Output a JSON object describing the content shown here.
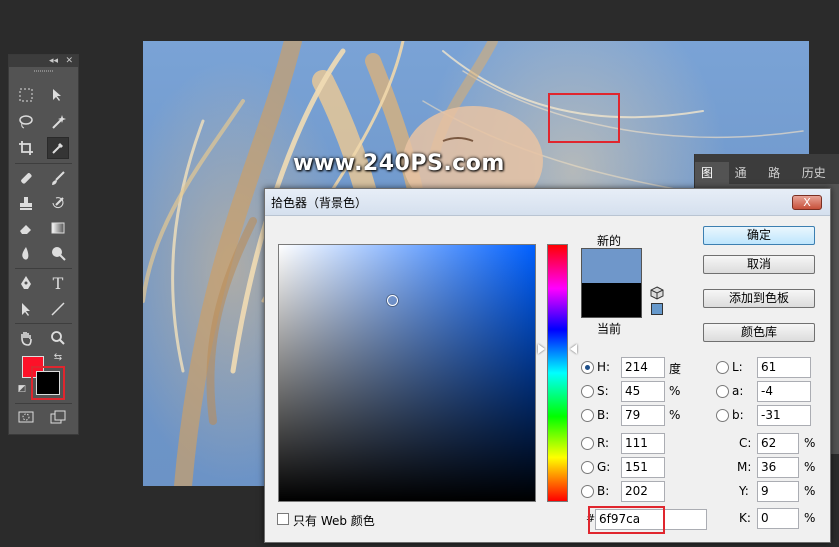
{
  "canvas": {
    "watermark": "www.240PS.com"
  },
  "toolbox": {
    "collapse_glyph": "◂◂",
    "close_glyph": "✕",
    "foreground_color": "#fd1128",
    "background_color": "#000000"
  },
  "layers_panel": {
    "tabs": [
      "图层",
      "通道",
      "路径",
      "历史记"
    ]
  },
  "dialog": {
    "title": "拾色器（背景色）",
    "close_label": "X",
    "new_label": "新的",
    "current_label": "当前",
    "new_color": "#6f97ca",
    "current_color": "#000000",
    "buttons": {
      "ok": "确定",
      "cancel": "取消",
      "add_to_swatches": "添加到色板",
      "color_libraries": "颜色库"
    },
    "hsb": {
      "h_label": "H:",
      "h_value": "214",
      "h_unit": "度",
      "s_label": "S:",
      "s_value": "45",
      "s_unit": "%",
      "b_label": "B:",
      "b_value": "79",
      "b_unit": "%"
    },
    "rgb": {
      "r_label": "R:",
      "r_value": "111",
      "g_label": "G:",
      "g_value": "151",
      "b_label": "B:",
      "b_value": "202"
    },
    "lab": {
      "l_label": "L:",
      "l_value": "61",
      "a_label": "a:",
      "a_value": "-4",
      "b_label": "b:",
      "b_value": "-31"
    },
    "cmyk": {
      "c_label": "C:",
      "c_value": "62",
      "m_label": "M:",
      "m_value": "36",
      "y_label": "Y:",
      "y_value": "9",
      "k_label": "K:",
      "k_value": "0",
      "unit": "%"
    },
    "hex_label": "#",
    "hex_value": "6f97ca",
    "web_only_label": "只有 Web 颜色"
  }
}
